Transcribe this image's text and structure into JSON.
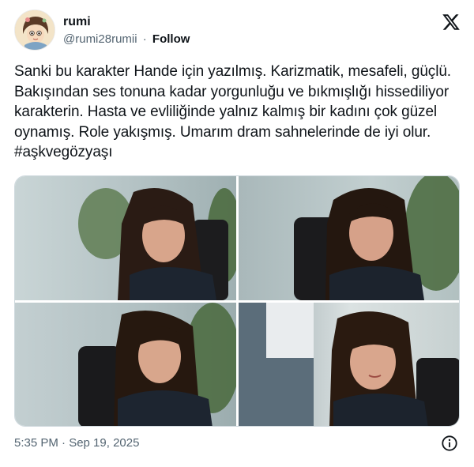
{
  "user": {
    "display_name": "rumi",
    "handle": "@rumi28rumii",
    "separator": "·",
    "follow_label": "Follow"
  },
  "tweet": {
    "text": "Sanki bu karakter Hande için yazılmış. Karizmatik, mesafeli, güçlü. Bakışından ses tonuna kadar yorgunluğu ve bıkmışlığı hissediliyor karakterin. Hasta ve evliliğinde yalnız kalmış bir kadını çok güzel oynamış. Role yakışmış. Umarım dram sahnelerinde de iyi olur. #aşkvegözyaşı"
  },
  "media": {
    "count": 4,
    "images": [
      "photo",
      "photo",
      "photo",
      "photo"
    ]
  },
  "footer": {
    "timestamp": "5:35 PM · Sep 19, 2025"
  },
  "icons": {
    "brand": "x-logo-icon",
    "info": "info-icon"
  },
  "colors": {
    "text": "#0f1419",
    "secondary": "#536471",
    "border": "#cfd9de"
  }
}
